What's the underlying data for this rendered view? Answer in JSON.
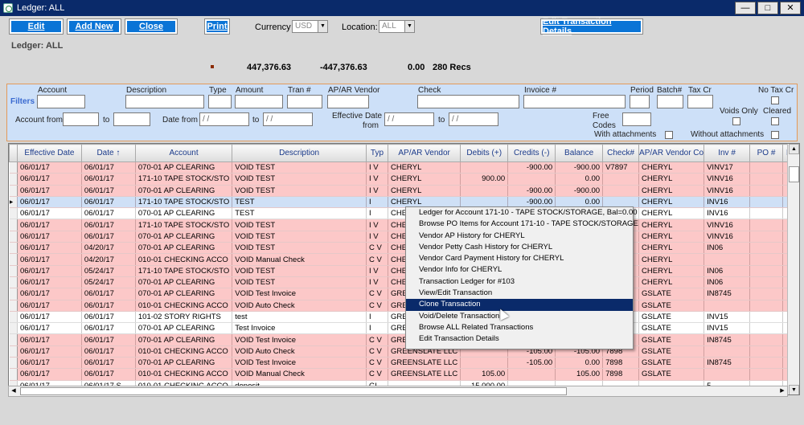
{
  "window": {
    "title": "Ledger: ALL"
  },
  "toolbar": {
    "edit": "Edit",
    "add_new": "Add New",
    "close": "Close",
    "print": "Print",
    "edit_details": "Edit Transaction Details"
  },
  "currency": {
    "label": "Currency",
    "value": "USD"
  },
  "location": {
    "label": "Location:",
    "value": "ALL"
  },
  "ledger_label": "Ledger: ALL",
  "totals": {
    "debits": "447,376.63",
    "credits": "-447,376.63",
    "balance": "0.00",
    "recs": "280 Recs"
  },
  "filters": {
    "title": "Filters",
    "account": "Account",
    "description": "Description",
    "type": "Type",
    "amount": "Amount",
    "tran": "Tran #",
    "vendor": "AP/AR Vendor",
    "check": "Check",
    "invoice": "Invoice #",
    "period": "Period",
    "batch": "Batch#",
    "taxcr": "Tax Cr",
    "notaxcr": "No Tax Cr",
    "voidsonly": "Voids Only",
    "cleared": "Cleared",
    "account_from": "Account from",
    "to": "to",
    "date_from": "Date from",
    "eff_date": "Effective Date",
    "eff_from": "from",
    "free": "Free",
    "codes": "Codes",
    "with_att": "With attachments",
    "without_att": "Without attachments",
    "date_placeholder": "/ /"
  },
  "columns": [
    "Effective Date",
    "Date ↑",
    "Account",
    "Description",
    "Typ",
    "AP/AR Vendor",
    "Debits (+)",
    "Credits (-)",
    "Balance",
    "Check#",
    "AP/AR Vendor Co",
    "Inv #",
    "PO #",
    "Im"
  ],
  "rows": [
    {
      "style": "pink",
      "c": [
        "06/01/17",
        "06/01/17",
        "070-01  AP CLEARING",
        "VOID TEST",
        "I  V",
        "CHERYL",
        "",
        "-900.00",
        "-900.00",
        "V7897",
        "CHERYL",
        "VINV17",
        "",
        ""
      ]
    },
    {
      "style": "pink",
      "c": [
        "06/01/17",
        "06/01/17",
        "171-10  TAPE STOCK/STO",
        "VOID TEST",
        "I  V",
        "CHERYL",
        "900.00",
        "",
        "0.00",
        "",
        "CHERYL",
        "VINV16",
        "",
        ""
      ]
    },
    {
      "style": "pink",
      "c": [
        "06/01/17",
        "06/01/17",
        "070-01  AP CLEARING",
        "VOID TEST",
        "I  V",
        "CHERYL",
        "",
        "-900.00",
        "-900.00",
        "",
        "CHERYL",
        "VINV16",
        "",
        ""
      ]
    },
    {
      "style": "sel",
      "c": [
        "06/01/17",
        "06/01/17",
        "171-10  TAPE STOCK/STO",
        "TEST",
        "I",
        "CHERYL",
        "",
        "-900.00",
        "0.00",
        "",
        "CHERYL",
        "INV16",
        "",
        ""
      ]
    },
    {
      "style": "white",
      "c": [
        "06/01/17",
        "06/01/17",
        "070-01  AP CLEARING",
        "TEST",
        "I",
        "CHERYL",
        "",
        "",
        "",
        "",
        "CHERYL",
        "INV16",
        "",
        ""
      ]
    },
    {
      "style": "pink",
      "c": [
        "06/01/17",
        "06/01/17",
        "171-10  TAPE STOCK/STO",
        "VOID TEST",
        "I  V",
        "CHERYL",
        "",
        "",
        "",
        "",
        "CHERYL",
        "VINV16",
        "",
        ""
      ]
    },
    {
      "style": "pink",
      "c": [
        "06/01/17",
        "06/01/17",
        "070-01  AP CLEARING",
        "VOID TEST",
        "I  V",
        "CHERYL",
        "",
        "",
        "",
        "",
        "CHERYL",
        "VINV16",
        "",
        ""
      ]
    },
    {
      "style": "pink",
      "c": [
        "06/01/17",
        "04/20/17",
        "070-01  AP CLEARING",
        "VOID TEST",
        "C  V",
        "CHERYL",
        "",
        "",
        "",
        "",
        "CHERYL",
        "IN06",
        "",
        ""
      ]
    },
    {
      "style": "pink",
      "c": [
        "06/01/17",
        "04/20/17",
        "010-01  CHECKING ACCO",
        "VOID Manual Check",
        "C  V",
        "CHERYL",
        "",
        "",
        "",
        "",
        "CHERYL",
        "",
        "",
        ""
      ]
    },
    {
      "style": "pink",
      "c": [
        "06/01/17",
        "05/24/17",
        "171-10  TAPE STOCK/STO",
        "VOID TEST",
        "I  V",
        "CHERYL",
        "",
        "",
        "",
        "",
        "CHERYL",
        "IN06",
        "",
        ""
      ]
    },
    {
      "style": "pink",
      "c": [
        "06/01/17",
        "05/24/17",
        "070-01  AP CLEARING",
        "VOID TEST",
        "I  V",
        "CHERYL",
        "",
        "",
        "",
        "",
        "CHERYL",
        "IN06",
        "",
        ""
      ]
    },
    {
      "style": "pink",
      "c": [
        "06/01/17",
        "06/01/17",
        "070-01  AP CLEARING",
        "VOID Test Invoice",
        "C  V",
        "GREENSLATE LLC",
        "",
        "",
        "",
        "",
        "GSLATE",
        "IN8745",
        "",
        ""
      ]
    },
    {
      "style": "pink",
      "c": [
        "06/01/17",
        "06/01/17",
        "010-01  CHECKING ACCO",
        "VOID Auto Check",
        "C  V",
        "GREENSLATE LLC",
        "",
        "",
        "",
        "",
        "GSLATE",
        "",
        "",
        ""
      ]
    },
    {
      "style": "white",
      "c": [
        "06/01/17",
        "06/01/17",
        "101-02  STORY RIGHTS",
        "test",
        "I",
        "GREENSLATE LLC",
        "",
        "",
        "",
        "",
        "GSLATE",
        "INV15",
        "",
        ""
      ]
    },
    {
      "style": "white",
      "c": [
        "06/01/17",
        "06/01/17",
        "070-01  AP CLEARING",
        "Test Invoice",
        "I",
        "GREENSLATE LLC",
        "",
        "",
        "",
        "",
        "GSLATE",
        "INV15",
        "",
        ""
      ]
    },
    {
      "style": "pink",
      "c": [
        "06/01/17",
        "06/01/17",
        "070-01  AP CLEARING",
        "VOID Test Invoice",
        "C  V",
        "GREENSLATE LLC",
        "",
        "",
        "",
        "",
        "GSLATE",
        "IN8745",
        "",
        ""
      ]
    },
    {
      "style": "pink",
      "c": [
        "06/01/17",
        "06/01/17",
        "010-01  CHECKING ACCO",
        "VOID Auto Check",
        "C  V",
        "GREENSLATE LLC",
        "",
        "-105.00",
        "-105.00",
        "7898",
        "GSLATE",
        "",
        "",
        ""
      ]
    },
    {
      "style": "pink",
      "c": [
        "06/01/17",
        "06/01/17",
        "070-01  AP CLEARING",
        "VOID Test Invoice",
        "C  V",
        "GREENSLATE LLC",
        "",
        "-105.00",
        "0.00",
        "7898",
        "GSLATE",
        "IN8745",
        "",
        ""
      ]
    },
    {
      "style": "pink",
      "c": [
        "06/01/17",
        "06/01/17",
        "010-01  CHECKING ACCO",
        "VOID Manual Check",
        "C  V",
        "GREENSLATE LLC",
        "105.00",
        "",
        "105.00",
        "7898",
        "GSLATE",
        "",
        "",
        ""
      ]
    },
    {
      "style": "white",
      "c": [
        "06/01/17",
        "06/01/17  S",
        "010-01  CHECKING ACCO",
        "deposit",
        "GL",
        "",
        "15,000.00",
        "",
        "",
        "",
        "",
        "5",
        "",
        ""
      ]
    }
  ],
  "context_menu": [
    "Ledger for Account 171-10 - TAPE STOCK/STORAGE,  Bal=0.00",
    "Browse PO Items for Account 171-10 - TAPE STOCK/STORAGE",
    "Vendor AP History for CHERYL",
    "Vendor Petty Cash History for CHERYL",
    "Vendor Card Payment History for CHERYL",
    "Vendor Info for CHERYL",
    "Transaction Ledger for #103",
    "View/Edit Transaction",
    "Clone Transaction",
    "Void/Delete Transaction",
    "Browse ALL Related Transactions",
    "Edit Transaction Details"
  ],
  "context_menu_highlight": 8,
  "colors": {
    "titlebar": "#0a2a6a",
    "button": "#0a74d6",
    "void_row": "#fcc8c8",
    "selected_row": "#cfe0f6",
    "filter_bg": "#cde0f8"
  }
}
